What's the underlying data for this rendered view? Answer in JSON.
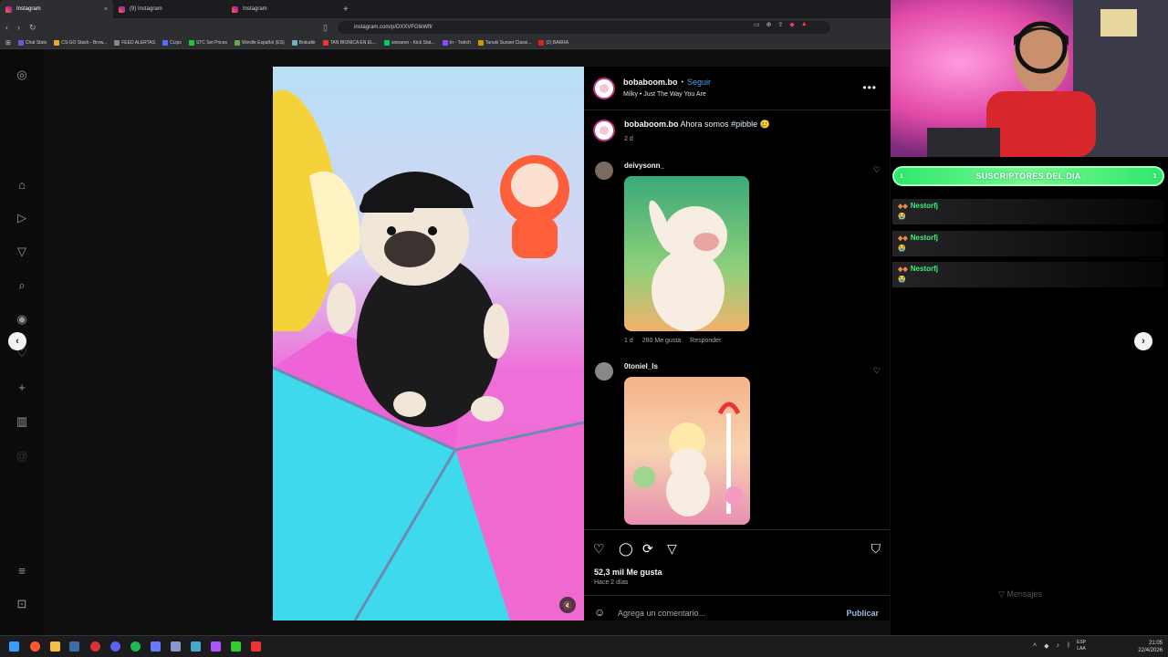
{
  "browser": {
    "tabs": [
      {
        "label": "Instagram",
        "active": true
      },
      {
        "label": "(9) Instagram",
        "active": false
      },
      {
        "label": "Instagram",
        "active": false
      }
    ],
    "tab_close": "×",
    "new_tab": "+",
    "url": "instagram.com/p/DXXVFGtkWfl/",
    "bookmarks": [
      "Chat Stats",
      "CS:GO Stash - Brow...",
      "FEED ALERTAS",
      "CLips",
      "STC Set Prices",
      "Wordle Español (ES)",
      "Bokudle",
      "TAN BIONICA EN EL...",
      "sionaron - Kick Stat...",
      "trr - Twitch",
      "Tanuki Sunset Classi...",
      "(2) BARRA"
    ]
  },
  "post": {
    "author": "bobaboom.bo",
    "follow_label": "Seguir",
    "separator": "•",
    "audio": "Milky • Just The Way You Are",
    "more": "•••",
    "caption_user": "bobaboom.bo",
    "caption_text": "Ahora somos",
    "caption_hashtag": "#pibble",
    "caption_emoji": "🥲",
    "caption_age": "2 d",
    "likes": "52,3 mil Me gusta",
    "posted": "Hace 2 días",
    "comment_placeholder": "Agrega un comentario...",
    "publish_label": "Publicar",
    "emoji_icon": "☺"
  },
  "comments": [
    {
      "user": "deivysonn_",
      "age": "1 d",
      "likes": "280 Me gusta",
      "reply": "Responder"
    },
    {
      "user": "0toniel_ls"
    }
  ],
  "overlay": {
    "subs_title": "SUSCRIPTORES DEL DIA",
    "subs_count_left": "1",
    "subs_count_right": "1",
    "chat": [
      {
        "user": "Nestorfj",
        "msg": "😭"
      },
      {
        "user": "Nestorfj",
        "msg": "😭"
      },
      {
        "user": "Nestorfj",
        "msg": "😭"
      }
    ],
    "messages_label": "Mensajes"
  },
  "taskbar": {
    "lang_top": "ESP",
    "lang_bottom": "LAA",
    "time": "21:05",
    "date": "22/4/2026"
  },
  "colors": {
    "accent_link": "#4aa3f5",
    "subs_green": "#2ee86d",
    "chat_green": "#3df07a"
  }
}
